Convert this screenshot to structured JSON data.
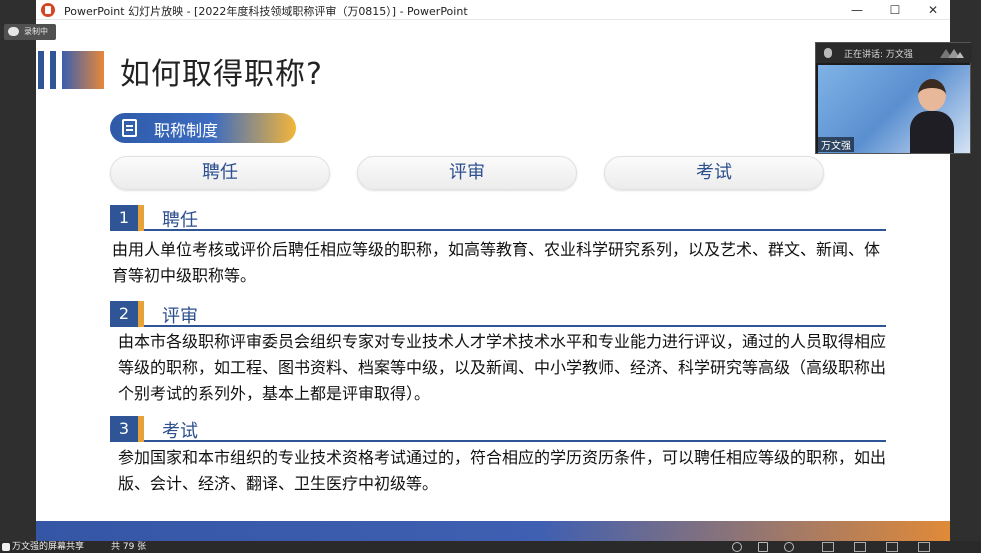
{
  "window": {
    "title": "PowerPoint 幻灯片放映 - [2022年度科技领域职称评审（万0815）] - PowerPoint",
    "minimize_glyph": "—",
    "maximize_glyph": "☐",
    "close_glyph": "✕"
  },
  "recording": {
    "label": "录制中"
  },
  "slide": {
    "title": "如何取得职称?",
    "system_pill": "职称制度",
    "categories": [
      "聘任",
      "评审",
      "考试"
    ],
    "sections": [
      {
        "num": "1",
        "title": "聘任",
        "body": "由用人单位考核或评价后聘任相应等级的职称，如高等教育、农业科学研究系列，以及艺术、群文、新闻、体育等初中级职称等。"
      },
      {
        "num": "2",
        "title": "评审",
        "body": "由本市各级职称评审委员会组织专家对专业技术人才学术技术水平和专业能力进行评议，通过的人员取得相应等级的职称，如工程、图书资料、档案等中级，以及新闻、中小学教师、经济、科学研究等高级（高级职称出个别考试的系列外，基本上都是评审取得）。"
      },
      {
        "num": "3",
        "title": "考试",
        "body": "参加国家和本市组织的专业技术资格考试通过的，符合相应的学历资历条件，可以聘任相应等级的职称，如出版、会计、经济、翻译、卫生医疗中初级等。"
      }
    ],
    "colors": {
      "accent_blue": "#2f5597",
      "accent_orange": "#e8a23a"
    }
  },
  "webcam": {
    "speaking_label": "正在讲话: 万文强",
    "name_tag": "万文强"
  },
  "share_bar": {
    "text": "万文强的屏幕共享",
    "page_count": "共 79 张"
  }
}
